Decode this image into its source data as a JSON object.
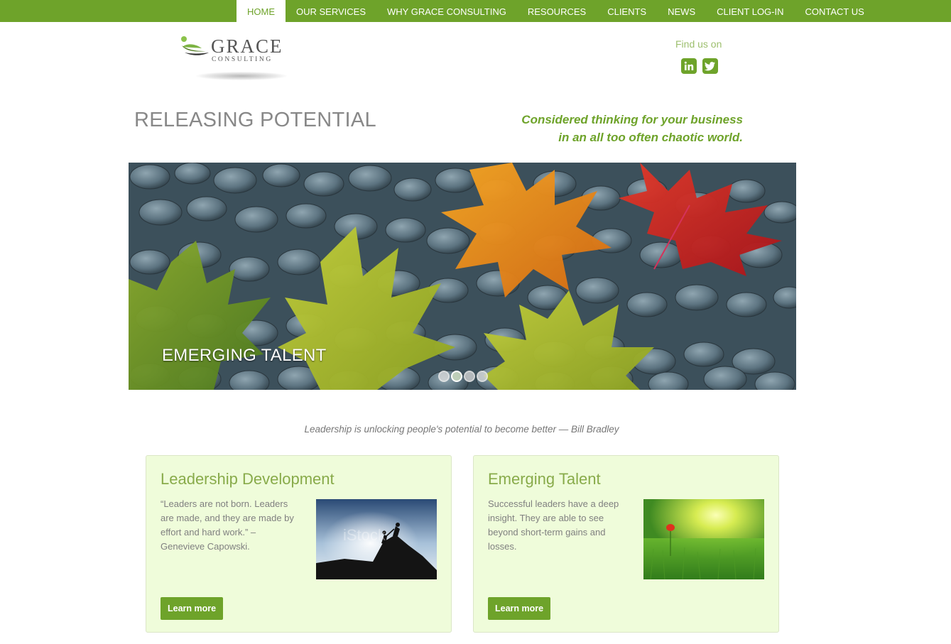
{
  "nav": {
    "items": [
      {
        "label": "HOME",
        "active": true
      },
      {
        "label": "OUR SERVICES",
        "active": false
      },
      {
        "label": "WHY GRACE CONSULTING",
        "active": false
      },
      {
        "label": "RESOURCES",
        "active": false
      },
      {
        "label": "CLIENTS",
        "active": false
      },
      {
        "label": "NEWS",
        "active": false
      },
      {
        "label": "CLIENT LOG-IN",
        "active": false
      },
      {
        "label": "CONTACT US",
        "active": false
      }
    ]
  },
  "logo": {
    "word": "GRACE",
    "sub": "CONSULTING"
  },
  "social": {
    "label": "Find us on",
    "icons": [
      "linkedin-icon",
      "twitter-icon"
    ]
  },
  "hero_header": {
    "headline": "RELEASING POTENTIAL",
    "tagline_line1": "Considered thinking for your business",
    "tagline_line2": "in an all too often chaotic world."
  },
  "slider": {
    "caption": "EMERGING TALENT",
    "slide_count": 4,
    "active_index": 1
  },
  "quote": "Leadership is unlocking people's potential to become better — Bill Bradley",
  "cards": [
    {
      "title": "Leadership Development",
      "text": "“Leaders are not born. Leaders are made, and they are made by effort and hard work.” – Genevieve Capowski.",
      "button": "Learn more",
      "image_label": "iStock"
    },
    {
      "title": "Emerging Talent",
      "text": "Successful leaders have a deep insight. They are able to see beyond short-term gains and losses.",
      "button": "Learn more"
    }
  ],
  "colors": {
    "brand_green": "#6ea32a",
    "card_bg": "#effcda"
  }
}
